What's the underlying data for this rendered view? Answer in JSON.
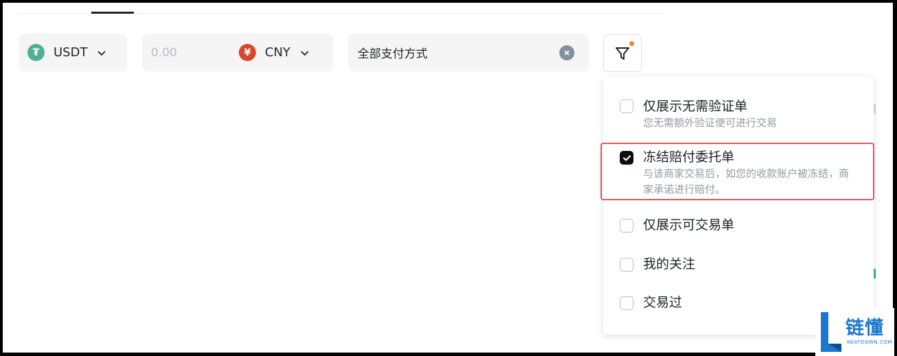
{
  "filters": {
    "coin": {
      "icon": "tether-icon",
      "symbol": "₮",
      "label": "USDT",
      "color": "#50af95"
    },
    "amount": {
      "placeholder": "0.00"
    },
    "fiat": {
      "icon": "yuan-icon",
      "symbol": "¥",
      "label": "CNY",
      "color": "#d9472b"
    },
    "payment": {
      "value": "全部支付方式",
      "clear_icon": "clear-icon"
    },
    "filter_button": {
      "icon": "filter-icon",
      "badge_color": "#f0822e"
    }
  },
  "dropdown": {
    "options": [
      {
        "title": "仅展示无需验证单",
        "desc": "您无需额外验证便可进行交易",
        "checked": false
      },
      {
        "title": "冻结赔付委托单",
        "desc": "与该商家交易后，如您的收款账户被冻结，商家承诺进行赔付。",
        "checked": true
      },
      {
        "title": "仅展示可交易单",
        "checked": false
      },
      {
        "title": "我的关注",
        "checked": false
      },
      {
        "title": "交易过",
        "checked": false
      }
    ]
  },
  "watermark": {
    "cn": "链懂",
    "en": "NEATDOWN.COM",
    "color": "#1b77d2"
  }
}
